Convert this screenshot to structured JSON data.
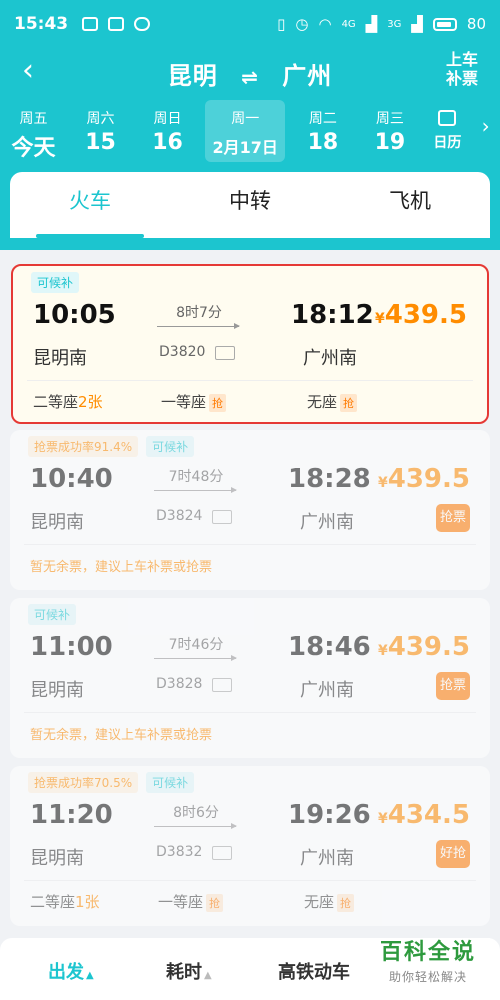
{
  "status": {
    "time": "15:43",
    "battery": "80",
    "net1": "4G",
    "net2": "3G"
  },
  "nav": {
    "from": "昆明",
    "to": "广州",
    "supp_l1": "上车",
    "supp_l2": "补票"
  },
  "dates": [
    {
      "weekday": "周五",
      "date": "今天"
    },
    {
      "weekday": "周六",
      "date": "15"
    },
    {
      "weekday": "周日",
      "date": "16"
    },
    {
      "weekday": "周一",
      "date": "2月17日",
      "selected": true
    },
    {
      "weekday": "周二",
      "date": "18"
    },
    {
      "weekday": "周三",
      "date": "19"
    }
  ],
  "calendar_label": "日历",
  "tabs": [
    "火车",
    "中转",
    "飞机"
  ],
  "trains": [
    {
      "badges": [
        "可候补"
      ],
      "dep_time": "10:05",
      "arr_time": "18:12",
      "dep_station": "昆明南",
      "arr_station": "广州南",
      "duration": "8时7分",
      "train_no": "D3820",
      "price_symbol": "¥",
      "price": "439.5",
      "seats": [
        {
          "name": "二等座",
          "count": "2张"
        },
        {
          "name": "一等座",
          "tag": "抢"
        },
        {
          "name": "无座",
          "tag": "抢"
        }
      ]
    },
    {
      "badges": [
        "抢票成功率91.4%",
        "可候补"
      ],
      "dep_time": "10:40",
      "arr_time": "18:28",
      "dep_station": "昆明南",
      "arr_station": "广州南",
      "duration": "7时48分",
      "train_no": "D3824",
      "price_symbol": "¥",
      "price": "439.5",
      "action": "抢票",
      "notice": "暂无余票，建议上车补票或抢票"
    },
    {
      "badges": [
        "可候补"
      ],
      "dep_time": "11:00",
      "arr_time": "18:46",
      "dep_station": "昆明南",
      "arr_station": "广州南",
      "duration": "7时46分",
      "train_no": "D3828",
      "price_symbol": "¥",
      "price": "439.5",
      "action": "抢票",
      "notice": "暂无余票，建议上车补票或抢票"
    },
    {
      "badges": [
        "抢票成功率70.5%",
        "可候补"
      ],
      "dep_time": "11:20",
      "arr_time": "19:26",
      "dep_station": "昆明南",
      "arr_station": "广州南",
      "duration": "8时6分",
      "train_no": "D3832",
      "price_symbol": "¥",
      "price": "434.5",
      "action": "好抢",
      "seats": [
        {
          "name": "二等座",
          "count": "1张"
        },
        {
          "name": "一等座",
          "tag": "抢"
        },
        {
          "name": "无座",
          "tag": "抢"
        }
      ]
    }
  ],
  "bottom": {
    "depart": "出发",
    "duration": "耗时",
    "highspeed": "高铁动车"
  },
  "watermark": {
    "title": "百科全说",
    "subtitle": "助你轻松解决"
  },
  "colors": {
    "accent": "#1cc5cf",
    "price": "#ff8c00",
    "highlight_border": "#e53935"
  }
}
